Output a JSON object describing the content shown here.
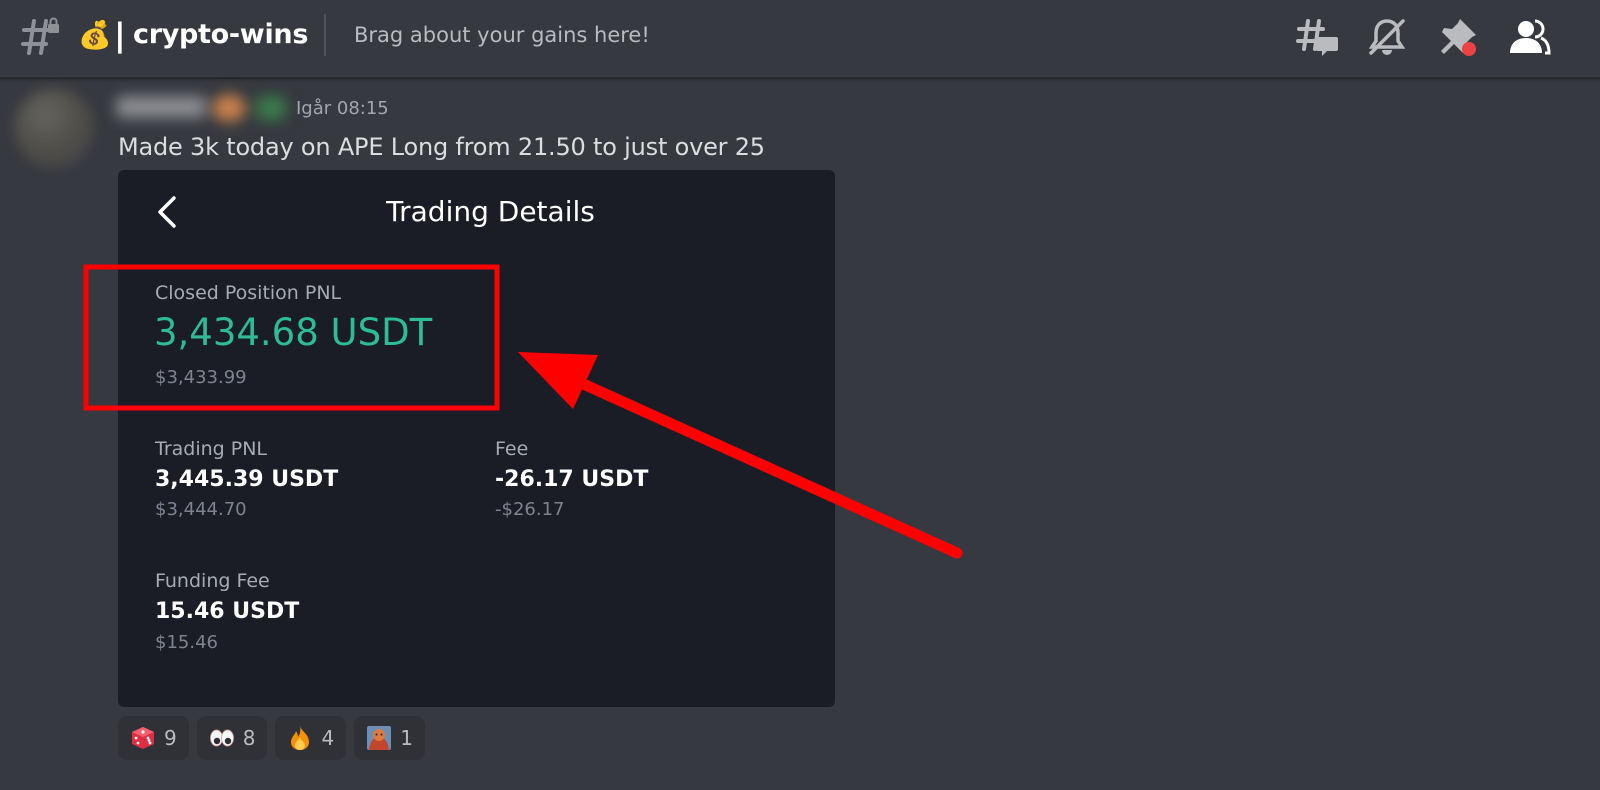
{
  "header": {
    "channel_emoji": "💰",
    "channel_separator": "|",
    "channel_name": "crypto-wins",
    "channel_topic": "Brag about your gains here!",
    "icons": [
      "threads-icon",
      "notification-muted-icon",
      "pinned-messages-icon",
      "member-list-icon"
    ]
  },
  "message": {
    "timestamp": "Igår 08:15",
    "text": "Made 3k today on APE Long from 21.50 to just over 25"
  },
  "trading_details": {
    "title": "Trading Details",
    "closed_position": {
      "label": "Closed Position PNL",
      "value": "3,434.68 USDT",
      "usd": "$3,433.99"
    },
    "trading_pnl": {
      "label": "Trading PNL",
      "value": "3,445.39 USDT",
      "usd": "$3,444.70"
    },
    "fee": {
      "label": "Fee",
      "value": "-26.17 USDT",
      "usd": "-$26.17"
    },
    "funding_fee": {
      "label": "Funding Fee",
      "value": "15.46 USDT",
      "usd": "$15.46"
    }
  },
  "reactions": [
    {
      "emoji": "game-die",
      "count": "9"
    },
    {
      "emoji": "eyes",
      "count": "8"
    },
    {
      "emoji": "fire",
      "count": "4"
    },
    {
      "emoji": "custom-emoji",
      "count": "1"
    }
  ],
  "colors": {
    "background": "#36393f",
    "card_background": "#1b1d26",
    "pnl_green": "#2dbc94",
    "annotation_red": "#ff0000"
  }
}
